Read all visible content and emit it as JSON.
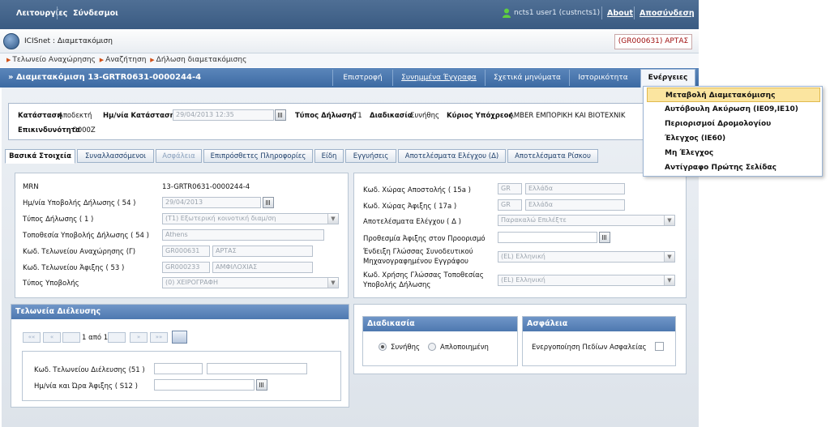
{
  "topbar": {
    "nav": [
      "Λειτουργίες",
      "Σύνδεσμοι"
    ],
    "user": "ncts1 user1 (custncts1)",
    "about": "About",
    "logout": "Αποσύνδεση"
  },
  "app": {
    "title": "ICISnet : Διαμετακόμιση",
    "office": "(GR000631) ΑΡΤΑΣ"
  },
  "breadcrumb": [
    "Τελωνείο Αναχώρησης",
    "Αναζήτηση",
    "Δήλωση διαμετακόμισης"
  ],
  "titlebar": {
    "title": "» Διαμετακόμιση 13-GRTR0631-0000244-4",
    "buttons": [
      "Επιστροφή",
      "Συνημμένα Έγγραφα",
      "Σχετικά μηνύματα",
      "Ιστορικότητα",
      "Ενέργειες"
    ]
  },
  "menu": {
    "items": [
      "Μεταβολή Διαμετακόμισης",
      "Αυτόβουλη Ακύρωση (ΙΕ09,ΙΕ10)",
      "Περιορισμοί Δρομολογίου",
      "Έλεγχος (ΙΕ60)",
      "Μη Έλεγχος",
      "Αντίγραφο Πρώτης Σελίδας"
    ]
  },
  "status": {
    "state_label": "Κατάσταση",
    "state_value": "Αποδεκτή",
    "date_label": "Ημ/νία Κατάστασης",
    "date_value": "29/04/2013 12:35",
    "type_label": "Τύπος Δήλωσης",
    "type_value": "T1",
    "proc_label": "Διαδικασία",
    "proc_value": "Συνήθης",
    "principal_label": "Κύριος Υπόχρεος",
    "principal_value": "AMBER ΕΜΠΟΡΙΚΗ ΚΑΙ ΒΙΟΤΕΧΝΙΚ",
    "danger_label": "Επικινδυνότητα",
    "danger_value": "O000Z"
  },
  "tabs": [
    "Βασικά Στοιχεία",
    "Συναλλασσόμενοι",
    "Ασφάλεια",
    "Επιπρόσθετες Πληροφορίες",
    "Είδη",
    "Εγγυήσεις",
    "Αποτελέσματα Ελέγχου (Δ)",
    "Αποτελέσματα Ρίσκου"
  ],
  "left_form": {
    "mrn_label": "MRN",
    "mrn_value": "13-GRTR0631-0000244-4",
    "submit_date_label": "Ημ/νία Υποβολής Δήλωσης ( 54 )",
    "submit_date_value": "29/04/2013",
    "decl_type_label": "Τύπος Δήλωσης ( 1 )",
    "decl_type_value": "(T1) Εξωτερική κοινοτική διαμ/ση",
    "place_label": "Τοποθεσία Υποβολής Δήλωσης ( 54 )",
    "place_value": "Athens",
    "dep_office_label": "Κωδ. Τελωνείου Αναχώρησης (Γ)",
    "dep_office_code": "GR000631",
    "dep_office_name": "ΑΡΤΑΣ",
    "dest_office_label": "Κωδ. Τελωνείου Άφιξης ( 53 )",
    "dest_office_code": "GR000233",
    "dest_office_name": "ΑΜΦΙΛΟΧΙΑΣ",
    "submit_type_label": "Τύπος Υποβολής",
    "submit_type_value": "(0) ΧΕΙΡΟΓΡΑΦΗ"
  },
  "right_form": {
    "dispatch_label": "Κωδ. Χώρας Αποστολής ( 15a )",
    "dispatch_code": "GR",
    "dispatch_name": "Ελλάδα",
    "dest_country_label": "Κωδ. Χώρας Άφιξης ( 17a )",
    "dest_country_code": "GR",
    "dest_country_name": "Ελλάδα",
    "control_label": "Αποτελέσματα Ελέγχου ( Δ )",
    "control_value": "Παρακαλώ Επιλέξτε",
    "deadline_label": "Προθεσμία Άφιξης στον Προορισμό",
    "lang_doc_label_1": "Ένδειξη Γλώσσας Συνοδευτικού",
    "lang_doc_label_2": "Μηχανογραφημένου Εγγράφου",
    "lang_doc_value": "(EL) Ελληνική",
    "lang_place_label_1": "Κωδ. Χρήσης Γλώσσας Τοποθεσίας",
    "lang_place_label_2": "Υποβολής Δήλωσης",
    "lang_place_value": "(EL) Ελληνική"
  },
  "transit": {
    "header": "Τελωνεία Διέλευσης",
    "pager": {
      "first": "««",
      "prev": "«",
      "page_text": "1 από 1",
      "next": "»",
      "last": "»»"
    },
    "office_label": "Κωδ. Τελωνείου Διέλευσης (51 )",
    "arrival_label": "Ημ/νία και Ώρα Άφιξης ( S12 )"
  },
  "procedure": {
    "header": "Διαδικασία",
    "opt1": "Συνήθης",
    "opt2": "Απλοποιημένη",
    "selected": "Συνήθης"
  },
  "security": {
    "header": "Ασφάλεια",
    "label": "Ενεργοποίηση Πεδίων Ασφαλείας"
  },
  "colors": {
    "top": "#3a5b82",
    "title": "#4a77ae",
    "menu_sel": "#fbe5a0",
    "office": "#a01010"
  }
}
